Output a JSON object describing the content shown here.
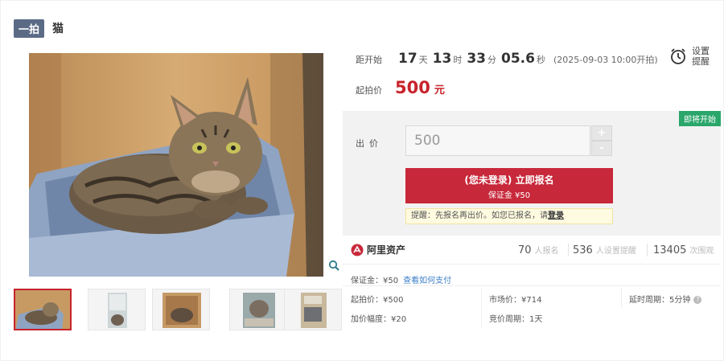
{
  "header": {
    "badge": "一拍",
    "title": "猫"
  },
  "countdown": {
    "label": "距开始",
    "days": "17",
    "days_unit": "天",
    "hours": "13",
    "hours_unit": "时",
    "minutes": "33",
    "minutes_unit": "分",
    "seconds": "05.6",
    "seconds_unit": "秒",
    "start_text": "(2025-09-03 10:00开拍)"
  },
  "start_price": {
    "label": "起拍价",
    "value": "500",
    "unit": "元"
  },
  "reminder": {
    "label": "设置提醒",
    "icon": "alarm-clock-icon"
  },
  "status_tag": "即将开始",
  "bid": {
    "label": "出价",
    "value": "500",
    "plus": "+",
    "minus": "-"
  },
  "signup": {
    "line1": "(您未登录) 立即报名",
    "line2": "保证金 ¥50"
  },
  "tip": {
    "prefix": "提醒：先报名再出价。如您已报名，请",
    "login": "登录"
  },
  "platform": {
    "name": "阿里资产"
  },
  "stats": [
    {
      "value": "70",
      "label": "人报名"
    },
    {
      "value": "536",
      "label": "人设置提醒"
    },
    {
      "value": "13405",
      "label": "次围观"
    }
  ],
  "info": {
    "deposit": "保证金：¥50",
    "pay_link": "查看如何支付",
    "start_price": "起拍价：¥500",
    "market_price": "市场价：¥714",
    "delay": "延时周期：5分钟",
    "increment": "加价幅度：¥20",
    "auction_period": "竞价周期：1天"
  },
  "colors": {
    "accent_red": "#c8232c",
    "badge": "#5b6b86",
    "soon_green": "#2aa66a",
    "link": "#3d7fc8"
  }
}
